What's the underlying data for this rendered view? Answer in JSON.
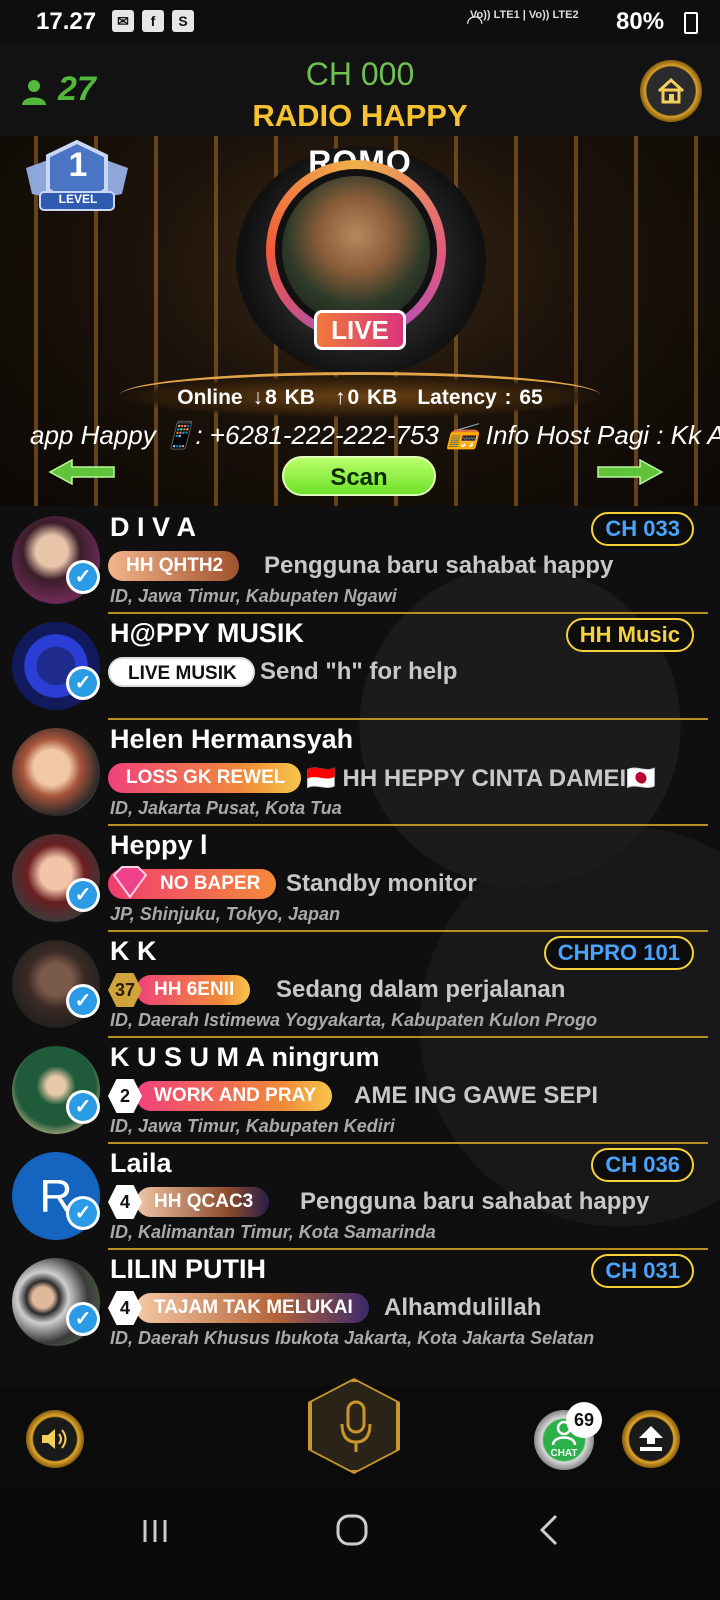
{
  "status_bar": {
    "time": "17.27",
    "network": "Vo)) LTE1 | Vo)) LTE2",
    "battery": "80%"
  },
  "header": {
    "listener_count": "27",
    "channel_code": "CH 000",
    "channel_name": "RADIO HAPPY"
  },
  "stage": {
    "level_label": "LEVEL",
    "level_number": "1",
    "host_name": "ROMO",
    "live_label": "LIVE",
    "stats": {
      "online": "Online",
      "download": "8 KB",
      "upload": "0 KB",
      "latency": "Latency : 65"
    },
    "marquee": "app Happy 📱: +6281-222-222-753 📻 Info Host Pagi : Kk A",
    "scan_label": "Scan"
  },
  "users": [
    {
      "name": "D I V A",
      "tag": "HH  QHTH2",
      "status": "Pengguna baru sahabat happy",
      "location": "ID, Jawa Timur, Kabupaten Ngawi",
      "channel": "CH 033"
    },
    {
      "name": "H@PPY MUSIK",
      "tag": "LIVE MUSIK",
      "status": "Send \"h\" for help",
      "location": "",
      "channel": "HH Music"
    },
    {
      "name": "Helen Hermansyah",
      "tag": "LOSS GK REWEL",
      "status": "🇮🇩 HH HEPPY CINTA DAMEI🇯🇵",
      "location": "ID, Jakarta Pusat, Kota Tua",
      "channel": ""
    },
    {
      "name": "Heppy l",
      "tag": "NO BAPER",
      "status": "Standby monitor",
      "location": "JP, Shinjuku, Tokyo, Japan",
      "channel": ""
    },
    {
      "name": "K K",
      "level": "37",
      "tag": "HH  6ENII",
      "status": "Sedang dalam perjalanan",
      "location": "ID, Daerah Istimewa Yogyakarta, Kabupaten Kulon Progo",
      "channel": "CHPRO 101"
    },
    {
      "name": "K U S U M A ningrum",
      "level": "2",
      "tag": "WORK AND PRAY",
      "status": "AME ING GAWE          SEPI",
      "location": "ID, Jawa Timur, Kabupaten Kediri",
      "channel": ""
    },
    {
      "name": "Laila",
      "level": "4",
      "tag": "HH  QCAC3",
      "status": "Pengguna baru sahabat happy",
      "location": "ID, Kalimantan Timur, Kota Samarinda",
      "channel": "CH 036",
      "avatar_letter": "R"
    },
    {
      "name": "LILIN PUTIH",
      "level": "4",
      "tag": "TAJAM TAK MELUKAI",
      "status": "Alhamdulillah",
      "location": "ID, Daerah Khusus Ibukota Jakarta, Kota Jakarta Selatan",
      "channel": "CH 031"
    }
  ],
  "bottom": {
    "chat_badge": "69",
    "chat_label": "CHAT"
  },
  "colors": {
    "accent_gold": "#f6c22f",
    "accent_green": "#52b93a",
    "channel_blue": "#4aa3ff",
    "verified_blue": "#2b9be6"
  },
  "icons": [
    "person-icon",
    "home-icon",
    "level-badge-icon",
    "download-arrow-icon",
    "upload-arrow-icon",
    "left-arrow-icon",
    "right-arrow-icon",
    "verified-icon",
    "diamond-icon",
    "speaker-icon",
    "microphone-icon",
    "chat-icon",
    "upload-icon",
    "recents-icon",
    "home-nav-icon",
    "back-icon"
  ]
}
